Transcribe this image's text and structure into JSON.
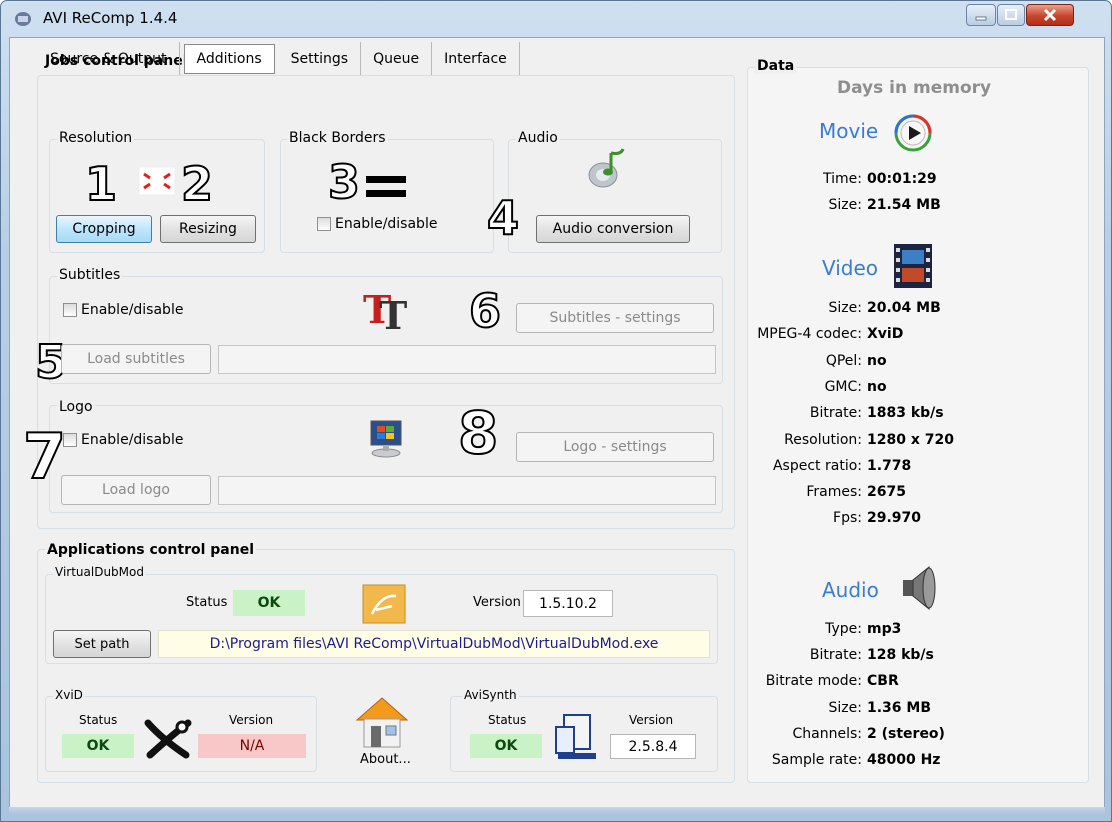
{
  "window": {
    "title": "AVI ReComp  1.4.4"
  },
  "jobs": {
    "title": "Jobs control panel",
    "tabs": [
      "Source & Output",
      "Additions",
      "Settings",
      "Queue",
      "Interface"
    ],
    "resolution": {
      "label": "Resolution",
      "cropping": "Cropping",
      "resizing": "Resizing"
    },
    "black_borders": {
      "label": "Black Borders",
      "enable": "Enable/disable"
    },
    "audio": {
      "label": "Audio",
      "conversion": "Audio conversion"
    },
    "subtitles": {
      "label": "Subtitles",
      "enable": "Enable/disable",
      "settings": "Subtitles - settings",
      "load": "Load subtitles"
    },
    "logo": {
      "label": "Logo",
      "enable": "Enable/disable",
      "settings": "Logo - settings",
      "load": "Load logo"
    },
    "numbers": [
      "1",
      "2",
      "3",
      "4",
      "5",
      "6",
      "7",
      "8"
    ]
  },
  "apps": {
    "title": "Applications control panel",
    "vdm": {
      "label": "VirtualDubMod",
      "status_label": "Status",
      "status": "OK",
      "version_label": "Version",
      "version": "1.5.10.2",
      "set_path": "Set path",
      "path": "D:\\Program files\\AVI ReComp\\VirtualDubMod\\VirtualDubMod.exe"
    },
    "xvid": {
      "label": "XviD",
      "status_label": "Status",
      "status": "OK",
      "version_label": "Version",
      "version": "N/A"
    },
    "about": "About...",
    "avisynth": {
      "label": "AviSynth",
      "status_label": "Status",
      "status": "OK",
      "version_label": "Version",
      "version": "2.5.8.4"
    }
  },
  "data": {
    "title": "Data",
    "days": "Days in memory",
    "movie": {
      "title": "Movie",
      "rows": [
        {
          "k": "Time:",
          "v": "00:01:29"
        },
        {
          "k": "Size:",
          "v": "21.54 MB"
        }
      ]
    },
    "video": {
      "title": "Video",
      "rows": [
        {
          "k": "Size:",
          "v": "20.04 MB"
        },
        {
          "k": "MPEG-4 codec:",
          "v": "XviD"
        },
        {
          "k": "QPel:",
          "v": "no"
        },
        {
          "k": "GMC:",
          "v": "no"
        },
        {
          "k": "Bitrate:",
          "v": "1883 kb/s"
        },
        {
          "k": "Resolution:",
          "v": "1280 x 720"
        },
        {
          "k": "Aspect ratio:",
          "v": "1.778"
        },
        {
          "k": "Frames:",
          "v": "2675"
        },
        {
          "k": "Fps:",
          "v": "29.970"
        }
      ]
    },
    "audio": {
      "title": "Audio",
      "rows": [
        {
          "k": "Type:",
          "v": "mp3"
        },
        {
          "k": "Bitrate:",
          "v": "128 kb/s"
        },
        {
          "k": "Bitrate mode:",
          "v": "CBR"
        },
        {
          "k": "Size:",
          "v": "1.36 MB"
        },
        {
          "k": "Channels:",
          "v": "2 (stereo)"
        },
        {
          "k": "Sample rate:",
          "v": "48000 Hz"
        }
      ]
    }
  }
}
